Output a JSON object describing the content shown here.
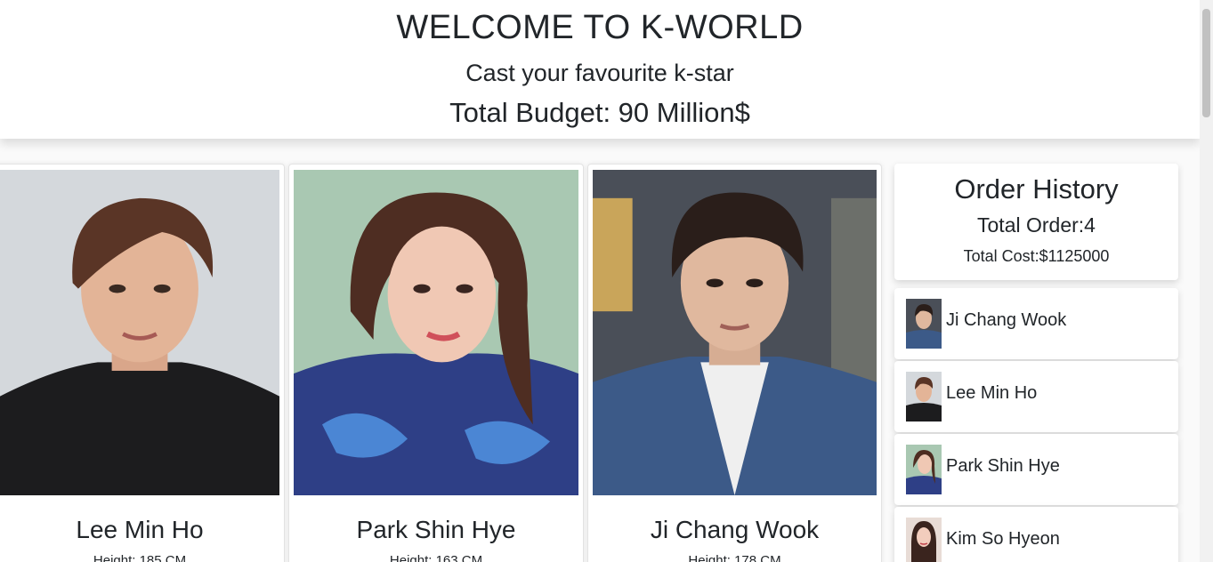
{
  "header": {
    "title": "WELCOME TO K-WORLD",
    "subtitle": "Cast your favourite k-star",
    "budget": "Total Budget: 90 Million$"
  },
  "cards": [
    {
      "name": "Lee Min Ho",
      "height": "Height: 185 CM"
    },
    {
      "name": "Park Shin Hye",
      "height": "Height: 163 CM"
    },
    {
      "name": "Ji Chang Wook",
      "height": "Height: 178 CM"
    }
  ],
  "order": {
    "title": "Order History",
    "total_order": "Total Order:4",
    "total_cost": "Total Cost:$1125000",
    "items": [
      {
        "name": "Ji Chang Wook"
      },
      {
        "name": "Lee Min Ho"
      },
      {
        "name": "Park Shin Hye"
      },
      {
        "name": "Kim So Hyeon"
      }
    ]
  }
}
